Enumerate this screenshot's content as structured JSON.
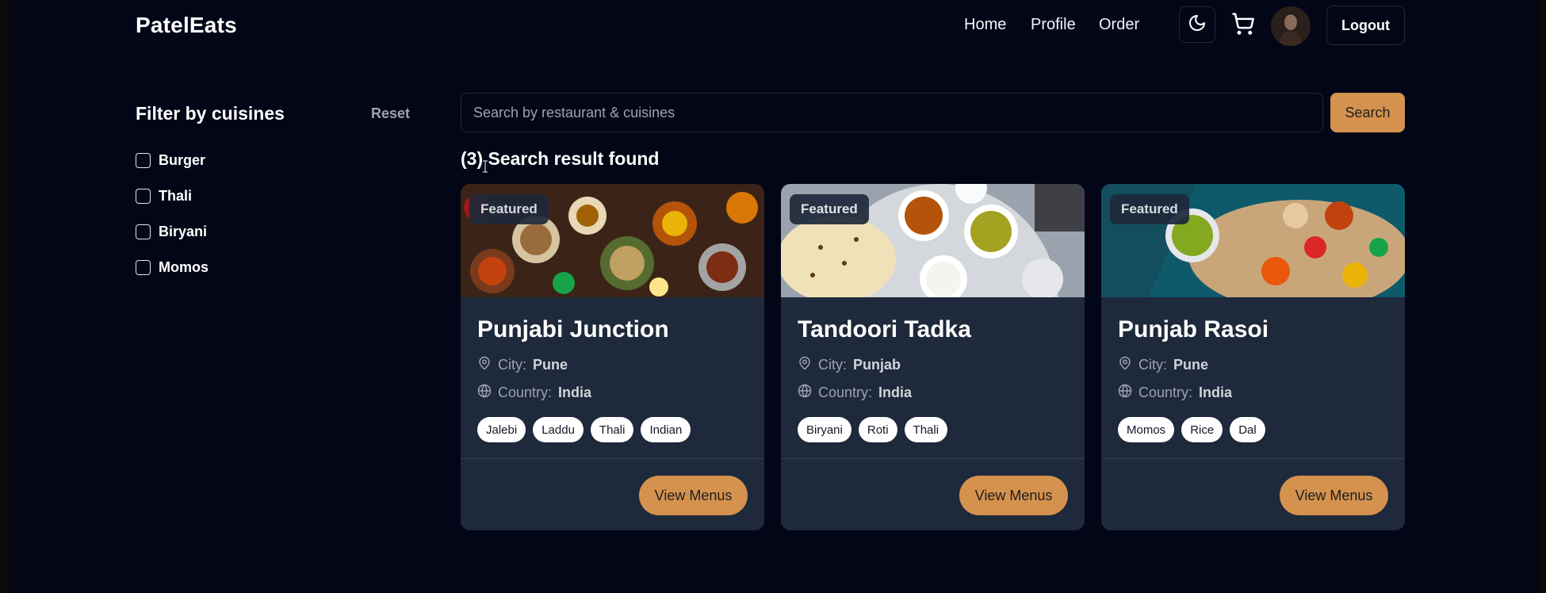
{
  "header": {
    "brand": "PatelEats",
    "nav": [
      {
        "label": "Home"
      },
      {
        "label": "Profile"
      },
      {
        "label": "Order"
      }
    ],
    "theme_icon": "moon-icon",
    "cart_icon": "cart-icon",
    "logout_label": "Logout"
  },
  "filter": {
    "title": "Filter by cuisines",
    "reset_label": "Reset",
    "options": [
      {
        "label": "Burger",
        "checked": false
      },
      {
        "label": "Thali",
        "checked": false
      },
      {
        "label": "Biryani",
        "checked": false
      },
      {
        "label": "Momos",
        "checked": false
      }
    ]
  },
  "search": {
    "placeholder": "Search by restaurant & cuisines",
    "button_label": "Search",
    "result_text": "(3) Search result found"
  },
  "colors": {
    "background": "#020617",
    "card": "#1e293b",
    "accent": "#d4924e"
  },
  "restaurants": [
    {
      "badge": "Featured",
      "name": "Punjabi Junction",
      "city_label": "City:",
      "city": "Pune",
      "country_label": "Country:",
      "country": "India",
      "tags": [
        "Jalebi",
        "Laddu",
        "Thali",
        "Indian"
      ],
      "button_label": "View Menus"
    },
    {
      "badge": "Featured",
      "name": "Tandoori Tadka",
      "city_label": "City:",
      "city": "Punjab",
      "country_label": "Country:",
      "country": "India",
      "tags": [
        "Biryani",
        "Roti",
        "Thali"
      ],
      "button_label": "View Menus"
    },
    {
      "badge": "Featured",
      "name": "Punjab Rasoi",
      "city_label": "City:",
      "city": "Pune",
      "country_label": "Country:",
      "country": "India",
      "tags": [
        "Momos",
        "Rice",
        "Dal"
      ],
      "button_label": "View Menus"
    }
  ]
}
